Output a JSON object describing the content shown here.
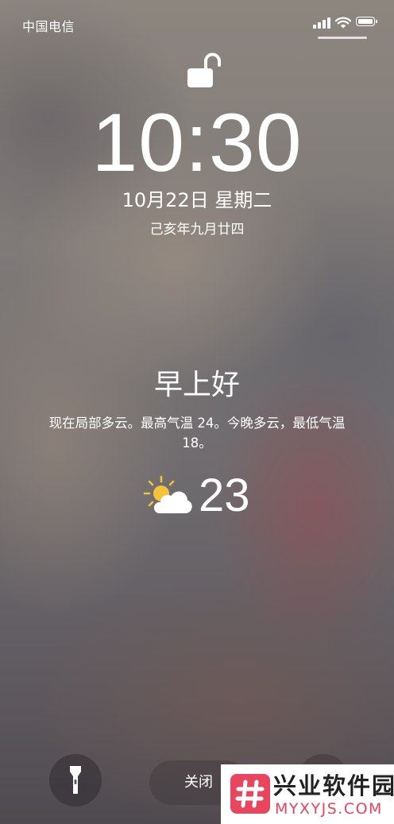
{
  "status_bar": {
    "carrier": "中国电信",
    "signal_bars": 4,
    "battery_level": 1.0
  },
  "lock_screen": {
    "time": "10:30",
    "date": "10月22日 星期二",
    "lunar_date": "己亥年九月廿四"
  },
  "weather": {
    "greeting": "早上好",
    "forecast": "现在局部多云。最高气温 24。今晚多云，最低气温 18。",
    "temperature": "23",
    "icon": "partly-sunny-icon"
  },
  "bottom": {
    "close_label": "关闭"
  },
  "watermark": {
    "title": "兴业软件园",
    "url": "MYXYJS.COM",
    "brand_color": "#e8455f"
  },
  "colors": {
    "text": "#ffffff",
    "sun": "#f5c23a"
  }
}
